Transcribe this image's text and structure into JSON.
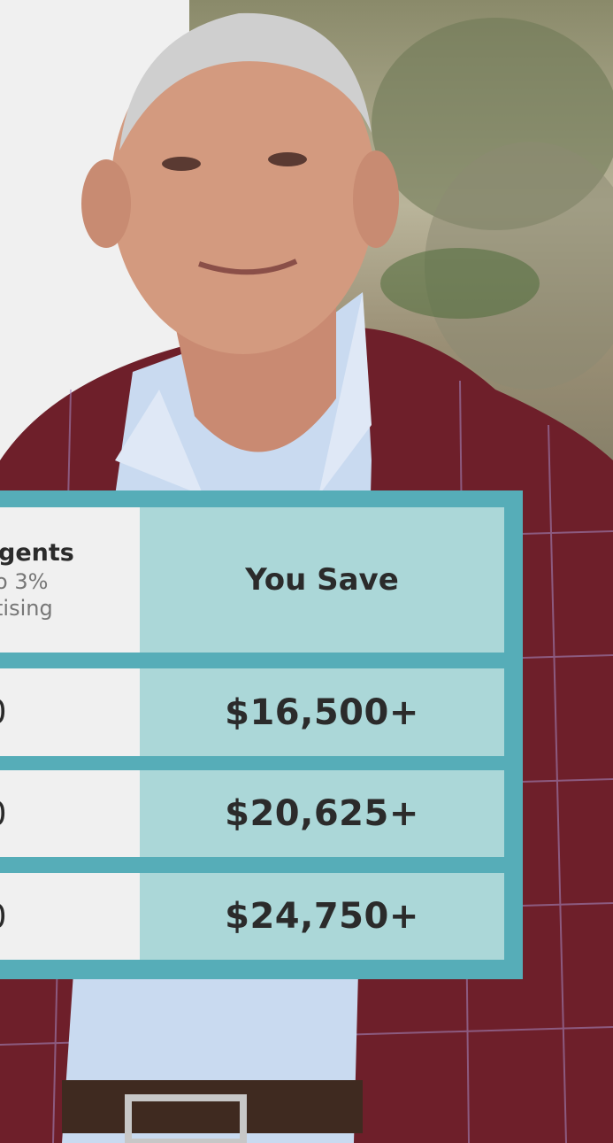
{
  "table": {
    "header": {
      "left_title": "gents",
      "left_sub1": "o 3%",
      "left_sub2": "tising",
      "right_title": "You Save"
    },
    "rows": [
      {
        "left": "0",
        "right": "$16,500+"
      },
      {
        "left": "0",
        "right": "$20,625+"
      },
      {
        "left": "0",
        "right": "$24,750+"
      }
    ]
  },
  "colors": {
    "border_teal": "#56adb8",
    "save_cell": "#abd7d8",
    "left_cell": "#f0f0f0",
    "text_dark": "#2b2b2b"
  }
}
